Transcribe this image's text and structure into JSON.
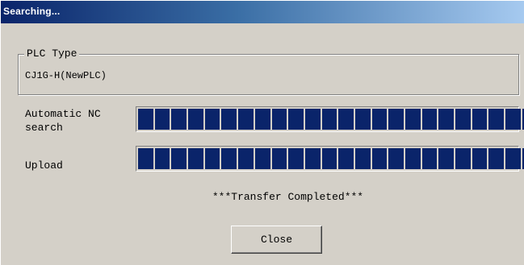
{
  "window": {
    "title": "Searching..."
  },
  "plc": {
    "group_label": "PLC Type",
    "value": "CJ1G-H(NewPLC)"
  },
  "progress": {
    "search": {
      "label_line1": "Automatic NC",
      "label_line2": "search",
      "fraction": 1.0,
      "segments": 24
    },
    "upload": {
      "label": "Upload",
      "fraction": 1.0,
      "segments": 24
    },
    "bar_color": "#0a246a"
  },
  "status": {
    "message": "***Transfer Completed***"
  },
  "buttons": {
    "close_label": "Close"
  },
  "colors": {
    "dialog_bg": "#d4d0c8",
    "title_start": "#0a246a",
    "title_end": "#a6caf0"
  }
}
